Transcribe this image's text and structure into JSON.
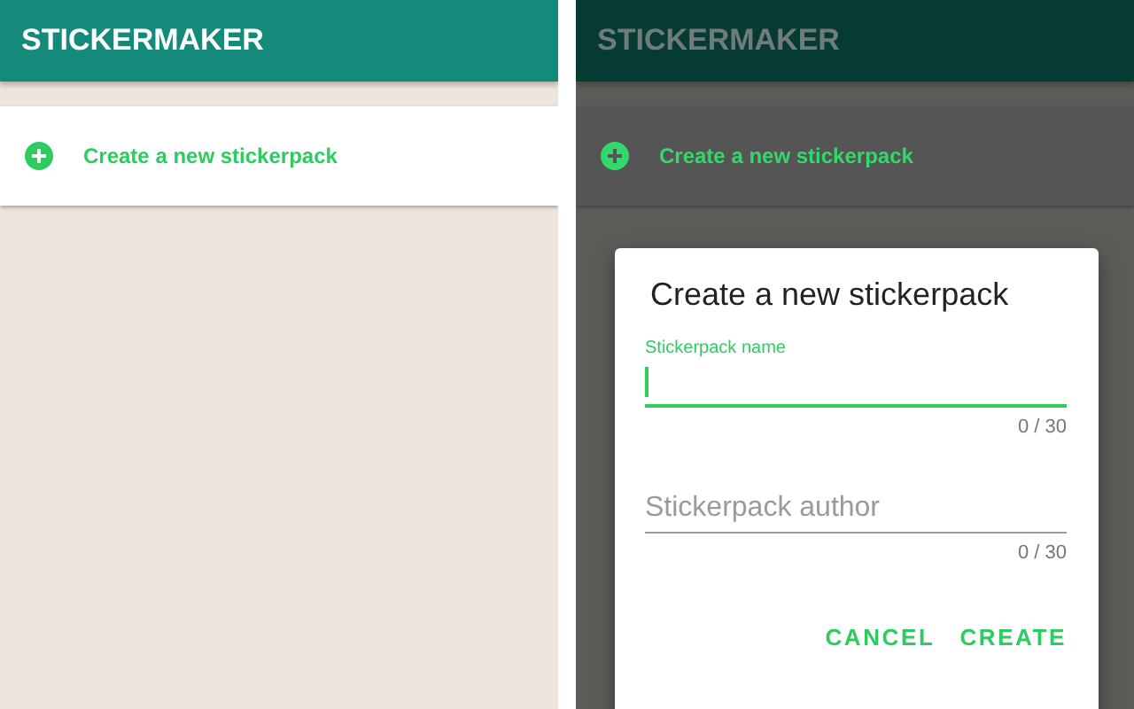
{
  "screens": [
    {
      "app_bar": {
        "title": "STICKERMAKER"
      },
      "create_item": {
        "label": "Create a new stickerpack"
      },
      "dimmed": false
    },
    {
      "app_bar": {
        "title": "STICKERMAKER"
      },
      "create_item": {
        "label": "Create a new stickerpack"
      },
      "dimmed": true,
      "dialog": {
        "title": "Create a new stickerpack",
        "fields": [
          {
            "label": "Stickerpack name",
            "focused": true,
            "counter": "0 / 30"
          },
          {
            "placeholder": "Stickerpack author",
            "focused": false,
            "counter": "0 / 30"
          }
        ],
        "buttons": [
          "CANCEL",
          "CREATE"
        ]
      }
    }
  ]
}
